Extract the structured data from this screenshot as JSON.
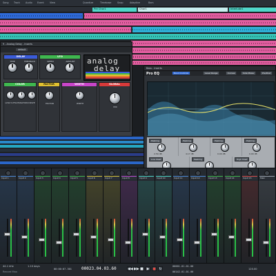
{
  "toolbar": {
    "items": [
      "Song",
      "Track",
      "Audio",
      "Event",
      "View",
      "Quantize",
      "Timebase",
      "Snap",
      "Adaptive",
      "Bars"
    ]
  },
  "arrangement": {
    "markers": [
      {
        "label": "Pre Chor1",
        "color": "#4fd7c9"
      },
      {
        "label": "Chor1",
        "color": "#c9f0f0"
      },
      {
        "label": "Interlude1",
        "color": "#4fd7c9"
      }
    ]
  },
  "delay_plugin": {
    "window_title": "9 - Analog Delay - Inserts",
    "preset": "default",
    "brand_line1": "analog",
    "brand_line2": "delay",
    "sections": [
      {
        "id": "delay",
        "label": "DELAY",
        "color": "#3a5bd9",
        "knobs": [
          "TIME",
          "FEEDBACK"
        ]
      },
      {
        "id": "lfo",
        "label": "LFO",
        "color": "#3fb84f",
        "knobs": [
          "SPEED",
          "AMOUNT"
        ]
      },
      {
        "id": "color",
        "label": "COLOR",
        "color": "#3fb84f",
        "knobs": [
          "LOW CUT",
          "SATURATION",
          "DRIVE"
        ]
      },
      {
        "id": "factor",
        "label": "FACTOR",
        "color": "#e0c030",
        "knobs": [
          "FACTOR"
        ]
      },
      {
        "id": "width",
        "label": "WIDTH",
        "color": "#c845c9",
        "knobs": [
          "WIDTH"
        ]
      },
      {
        "id": "global",
        "label": "GLOBAL",
        "color": "#d83a3a",
        "knobs": [
          "MIX"
        ]
      }
    ]
  },
  "eq_plugin": {
    "window_title": "Bass - Inserts",
    "title": "Pro EQ",
    "toolbar": [
      "Band Controls",
      "Level Range",
      "Curves",
      "Side Mixes",
      "Pre/Post"
    ],
    "band_row1": [
      "Peaking",
      "Peaking",
      "Peaking",
      "Peaking"
    ],
    "band_row2": [
      "Low Shelf",
      "Peaking",
      "High Shelf"
    ],
    "values_row1": [
      "2.50 dB",
      "4.17 dB",
      "0.00 dB",
      "0.00 dB"
    ],
    "values_row2": [
      "80.0 Hz",
      "1.70",
      "2.00 kHz"
    ]
  },
  "mixer": {
    "channels": [
      {
        "name": "Input 1",
        "color": "#4e8cd8"
      },
      {
        "name": "Input 2",
        "color": "#4e8cd8"
      },
      {
        "name": "Input 3",
        "color": "#3fb84f"
      },
      {
        "name": "Input 4",
        "color": "#3fb84f"
      },
      {
        "name": "Input 5",
        "color": "#3fb84f"
      },
      {
        "name": "Input 6",
        "color": "#d8c640"
      },
      {
        "name": "Input 7",
        "color": "#d8c640"
      },
      {
        "name": "Input 8",
        "color": "#c24fd8"
      },
      {
        "name": "Input 9",
        "color": "#4fd7c9"
      },
      {
        "name": "Input 10",
        "color": "#4fd7c9"
      },
      {
        "name": "Input 11",
        "color": "#4e8cd8"
      },
      {
        "name": "Input 12",
        "color": "#4e8cd8"
      },
      {
        "name": "Input 13",
        "color": "#3fb84f"
      },
      {
        "name": "Input 14",
        "color": "#3fb84f"
      },
      {
        "name": "Input 15",
        "color": "#d84f4f"
      },
      {
        "name": "Main",
        "color": "#9aa3ad"
      }
    ]
  },
  "transport": {
    "sample_rate": "44.1 kHz",
    "latency": "1.10 days",
    "record_max": "Record Max",
    "timecode": "00:00:07.301",
    "position": "00023.04.03.60",
    "loop_start": "00001.01.01.00",
    "loop_end": "00142.01.01.00",
    "tempo": "120.00"
  }
}
